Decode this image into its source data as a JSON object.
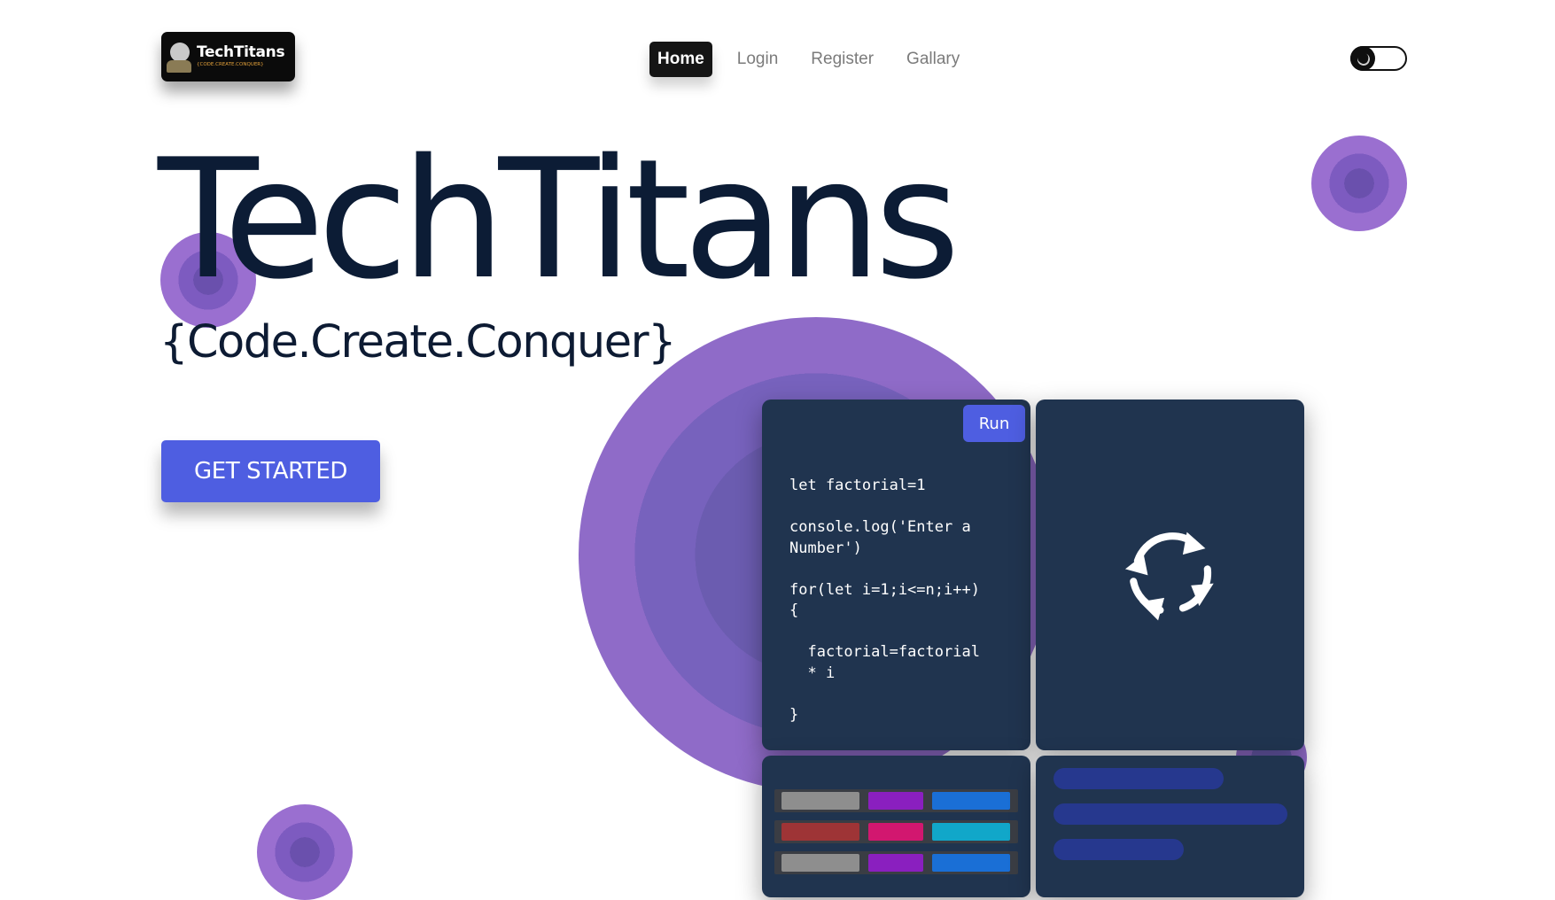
{
  "brand": {
    "logo_title": "TechTitans",
    "logo_subtitle": "{CODE.CREATE.CONQUER}"
  },
  "nav": {
    "items": [
      {
        "label": "Home",
        "active": true
      },
      {
        "label": "Login",
        "active": false
      },
      {
        "label": "Register",
        "active": false
      },
      {
        "label": "Gallary",
        "active": false
      }
    ]
  },
  "theme_toggle": {
    "mode": "dark",
    "icon": "moon-icon"
  },
  "hero": {
    "title": "TechTitans",
    "tagline": "{Code.Create.Conquer}",
    "cta_label": "GET STARTED"
  },
  "code_card": {
    "run_label": "Run",
    "code": "let factorial=1\n\nconsole.log('Enter a Number')\n\nfor(let i=1;i<=n;i++)\n{\n\n  factorial=factorial\n  * i\n\n}"
  },
  "sync_card": {
    "icon": "sync-arrows-icon"
  },
  "colors": {
    "accent": "#4e5ee1",
    "title": "#0c1c35",
    "card_bg": "#20344f",
    "ring_outer": "#bd91d3",
    "ring_inner": "#6b5cb0"
  },
  "swatch_card": {
    "rows": [
      [
        "#8e8e8e",
        "#8a1fbf",
        "#1a6fd6"
      ],
      [
        "#9e3436",
        "#d2176f",
        "#11a7c9"
      ],
      [
        "#8e8e8e",
        "#8a1fbf",
        "#1a6fd6"
      ]
    ]
  }
}
